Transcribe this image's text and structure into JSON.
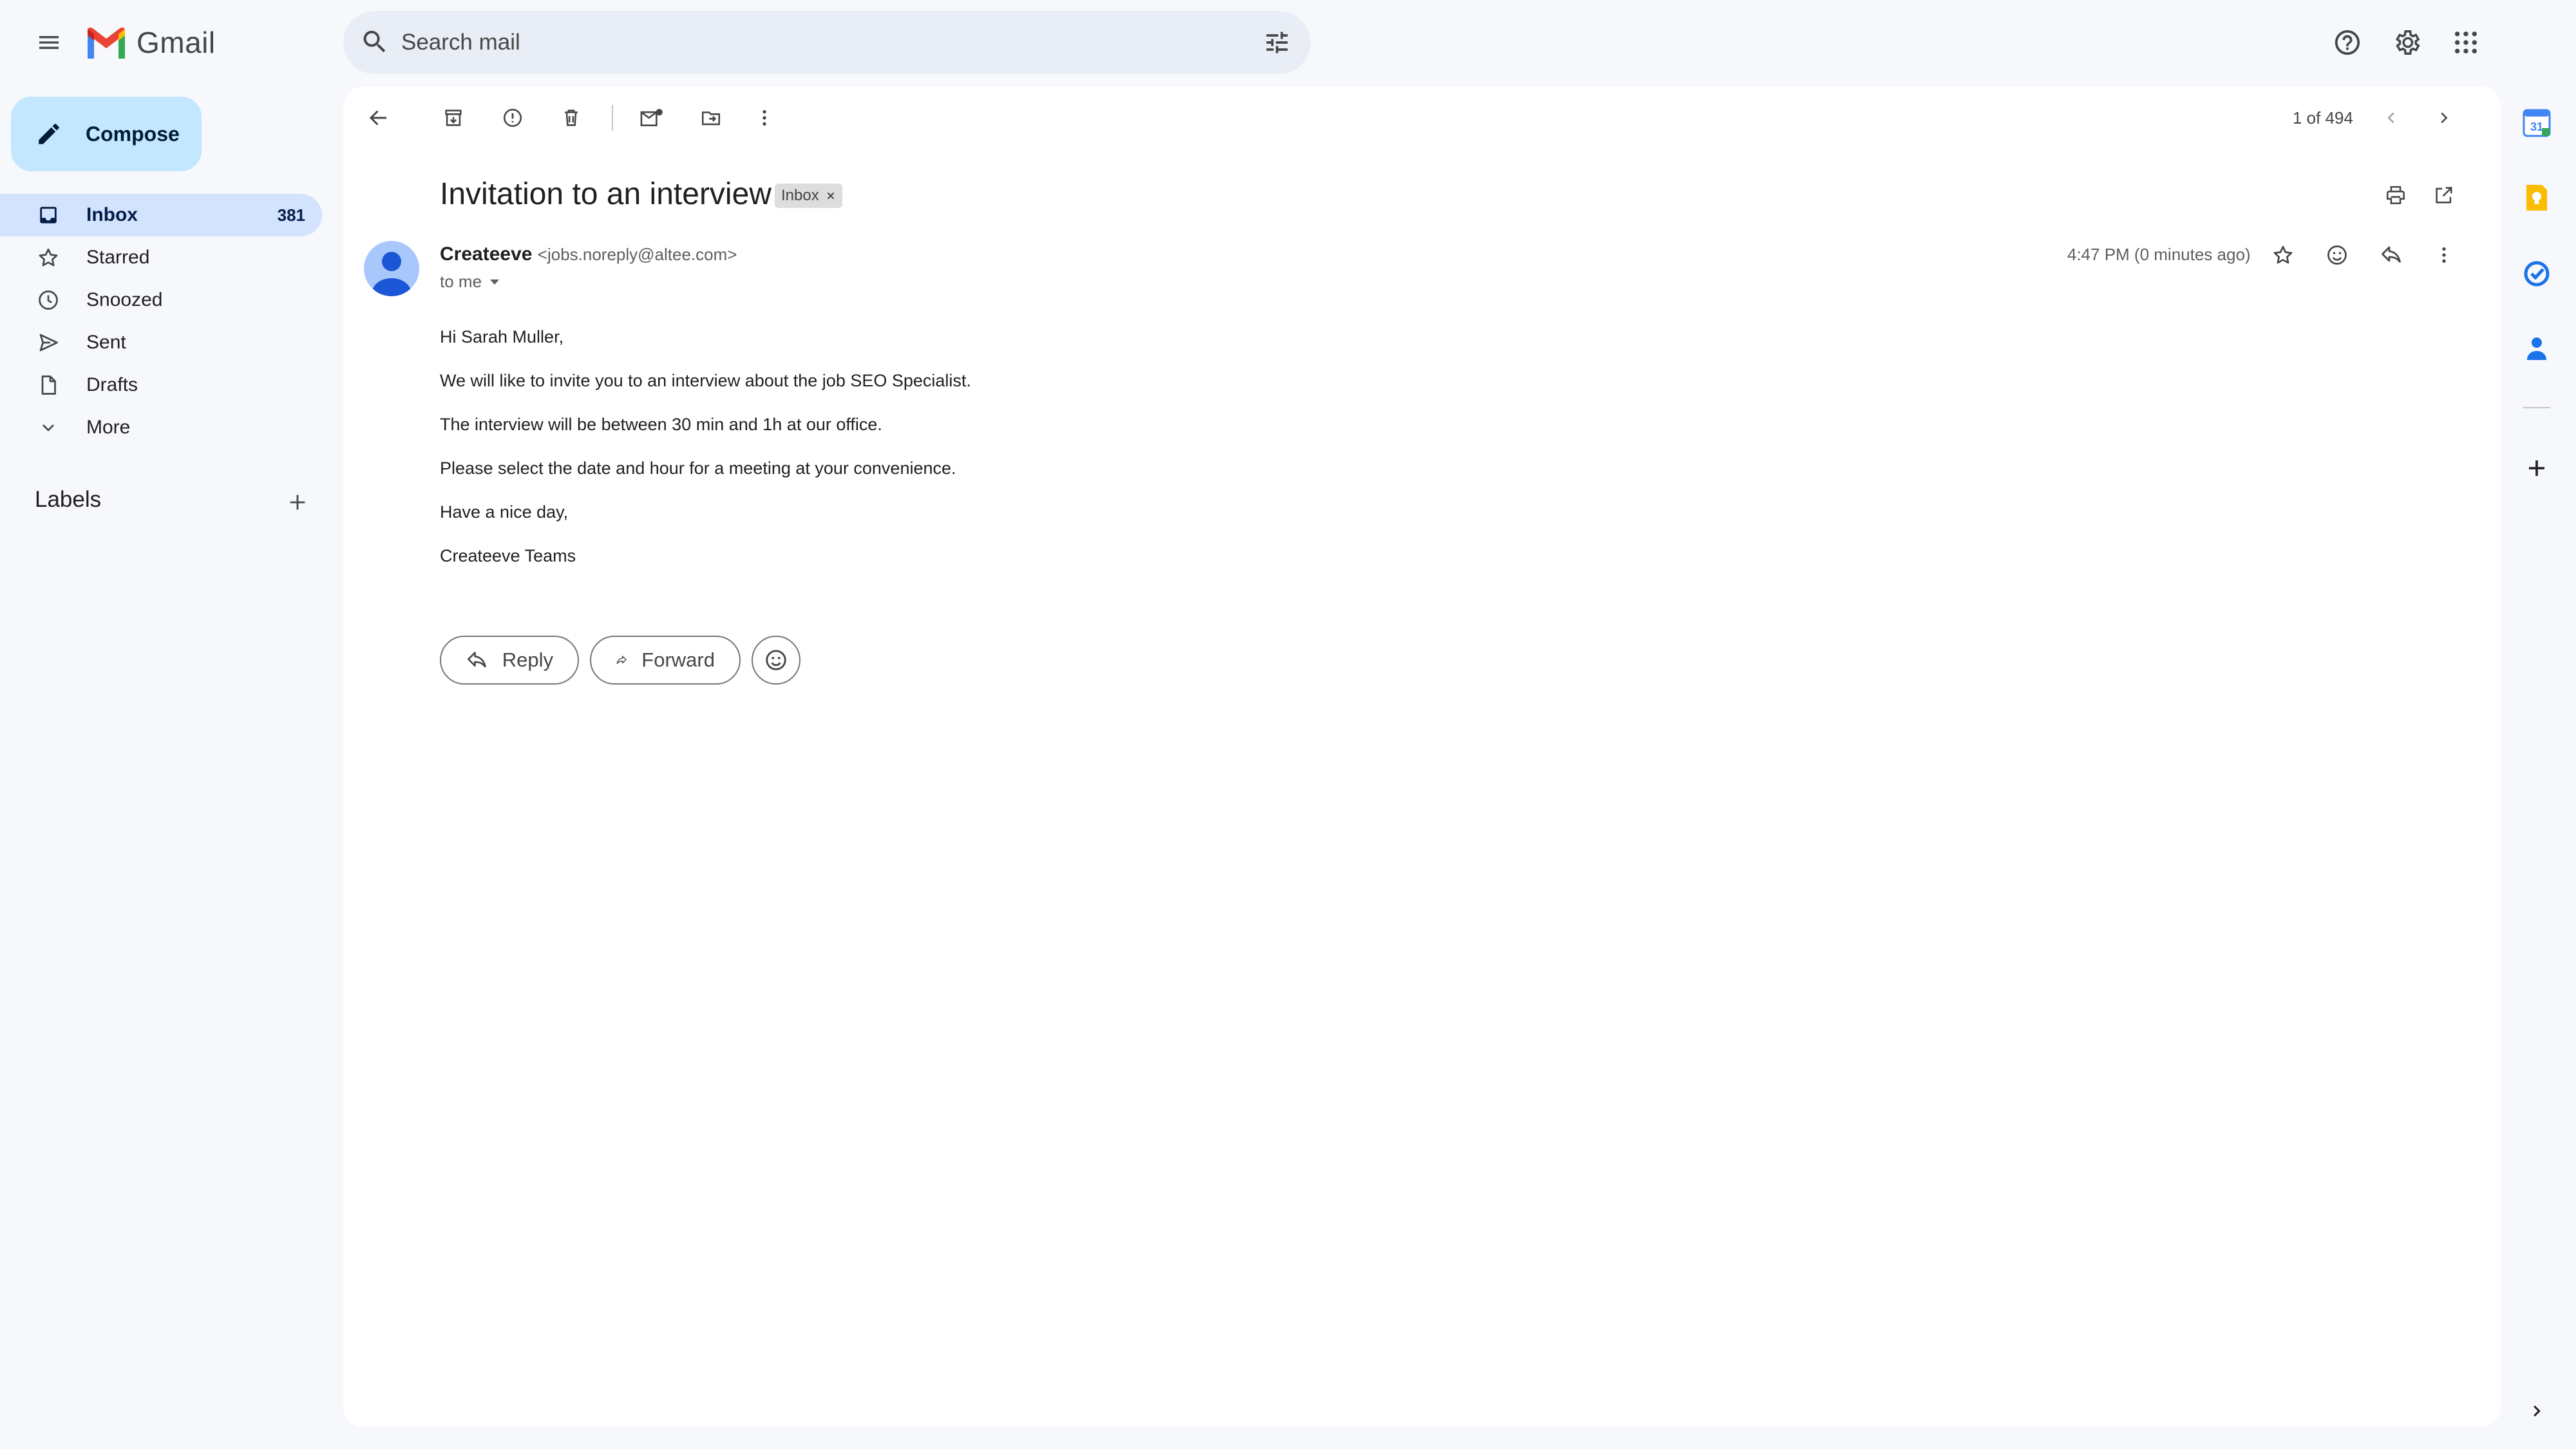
{
  "app": {
    "name": "Gmail"
  },
  "search": {
    "placeholder": "Search mail"
  },
  "sidebar": {
    "compose_label": "Compose",
    "items": [
      {
        "label": "Inbox",
        "count": "381",
        "icon": "inbox-icon",
        "active": true
      },
      {
        "label": "Starred",
        "icon": "star-icon"
      },
      {
        "label": "Snoozed",
        "icon": "clock-icon"
      },
      {
        "label": "Sent",
        "icon": "send-icon"
      },
      {
        "label": "Drafts",
        "icon": "draft-icon"
      },
      {
        "label": "More",
        "icon": "chevron-down-icon"
      }
    ],
    "labels_title": "Labels"
  },
  "toolbar": {
    "pager": "1 of 494"
  },
  "message": {
    "subject": "Invitation to an interview",
    "chip": "Inbox",
    "sender_name": "Createeve",
    "sender_email": "<jobs.noreply@altee.com>",
    "to": "to me",
    "timestamp": "4:47 PM (0 minutes ago)",
    "body": [
      "Hi Sarah Muller,",
      "We will like to invite you to an interview about the job SEO Specialist.",
      "The interview will be between 30 min and 1h at our office.",
      "Please select the date and hour for a meeting at your convenience.",
      "Have a nice day,",
      "Createeve Teams"
    ]
  },
  "actions": {
    "reply": "Reply",
    "forward": "Forward"
  },
  "side_panel": {
    "calendar_day": "31",
    "icons": [
      "calendar-icon",
      "keep-icon",
      "tasks-icon",
      "contacts-icon",
      "add-icon"
    ]
  },
  "colors": {
    "background": "#f6f8fc",
    "compose": "#c2e7ff",
    "active_nav": "#d3e3fd",
    "search": "#e9eef6"
  }
}
